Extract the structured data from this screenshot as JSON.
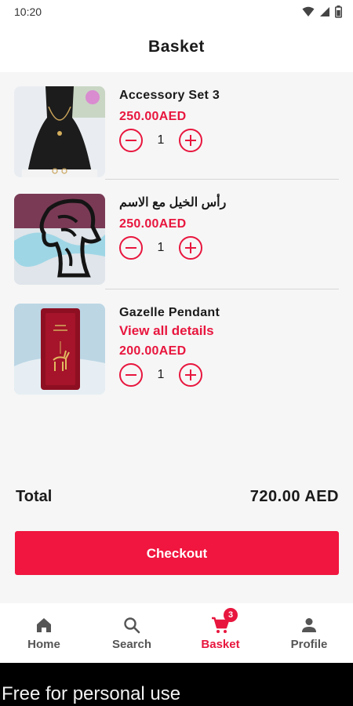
{
  "status": {
    "time": "10:20",
    "icons": [
      "wifi-icon",
      "signal-icon",
      "battery-icon"
    ]
  },
  "header": {
    "title": "Basket"
  },
  "items": [
    {
      "name": "Accessory Set 3",
      "link": "",
      "price": "250.00AED",
      "qty": "1",
      "image": "necklace-on-bust"
    },
    {
      "name": "رأس الخيل مع الاسم",
      "link": "",
      "price": "250.00AED",
      "qty": "1",
      "image": "horse-head-cutout"
    },
    {
      "name": "Gazelle Pendant",
      "link": "View all details",
      "price": "200.00AED",
      "qty": "1",
      "image": "gazelle-pendant-box"
    }
  ],
  "summary": {
    "total_label": "Total",
    "total_value": "720.00 AED"
  },
  "checkout": {
    "label": "Checkout"
  },
  "nav": {
    "tabs": [
      {
        "label": "Home",
        "icon": "home-icon"
      },
      {
        "label": "Search",
        "icon": "search-icon"
      },
      {
        "label": "Basket",
        "icon": "cart-icon",
        "badge": "3",
        "active": true
      },
      {
        "label": "Profile",
        "icon": "person-icon"
      }
    ]
  },
  "footer": {
    "text": "Free for personal use"
  },
  "colors": {
    "accent": "#e8163e",
    "button": "#f0163f"
  }
}
